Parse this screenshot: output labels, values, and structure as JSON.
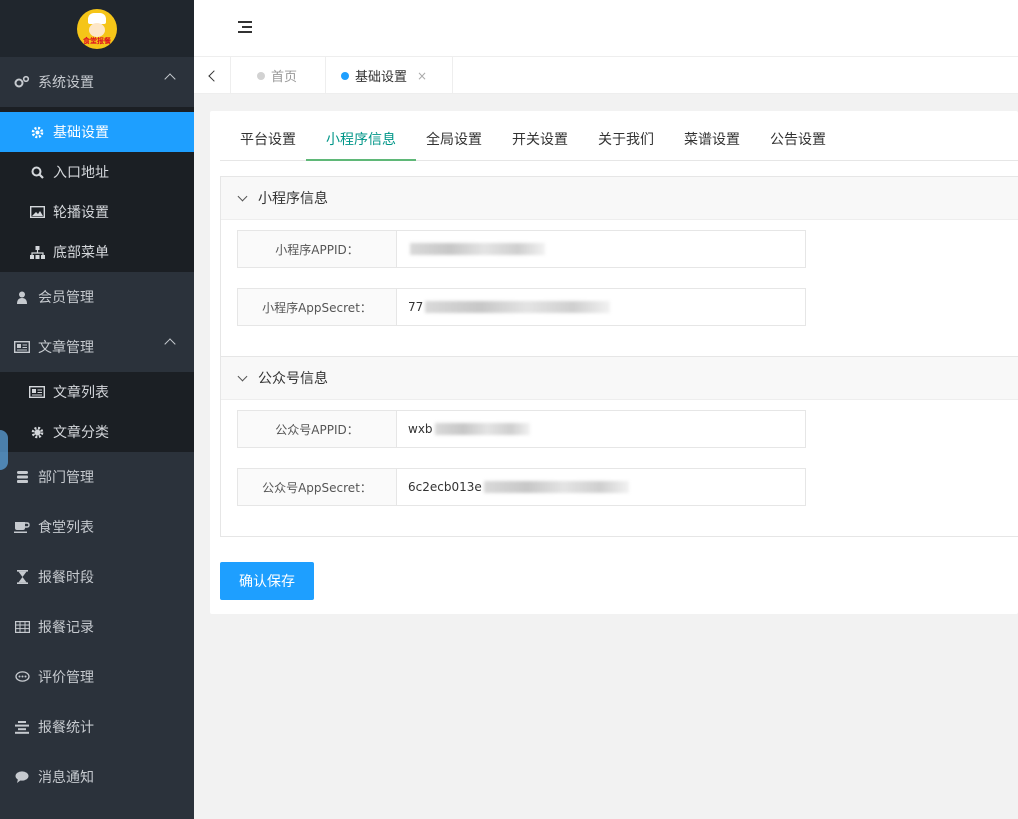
{
  "logo": {
    "text": "食堂报餐"
  },
  "sidebar": {
    "groups": [
      {
        "label": "系统设置",
        "icon": "gears-icon",
        "expanded": true,
        "items": [
          {
            "label": "基础设置",
            "icon": "gear-icon",
            "active": true
          },
          {
            "label": "入口地址",
            "icon": "search-icon"
          },
          {
            "label": "轮播设置",
            "icon": "image-icon"
          },
          {
            "label": "底部菜单",
            "icon": "sitemap-icon"
          }
        ]
      },
      {
        "label": "会员管理",
        "icon": "user-icon"
      },
      {
        "label": "文章管理",
        "icon": "newspaper-icon",
        "expanded": true,
        "items": [
          {
            "label": "文章列表",
            "icon": "newspaper-icon"
          },
          {
            "label": "文章分类",
            "icon": "cog-icon"
          }
        ]
      },
      {
        "label": "部门管理",
        "icon": "database-icon"
      },
      {
        "label": "食堂列表",
        "icon": "coffee-icon"
      },
      {
        "label": "报餐时段",
        "icon": "hourglass-icon"
      },
      {
        "label": "报餐记录",
        "icon": "table-icon"
      },
      {
        "label": "评价管理",
        "icon": "comment-dots-icon"
      },
      {
        "label": "报餐统计",
        "icon": "align-center-icon"
      },
      {
        "label": "消息通知",
        "icon": "comment-icon"
      }
    ]
  },
  "tabs": [
    {
      "label": "首页",
      "active": false
    },
    {
      "label": "基础设置",
      "active": true,
      "close": "×"
    }
  ],
  "inner_tabs": [
    "平台设置",
    "小程序信息",
    "全局设置",
    "开关设置",
    "关于我们",
    "菜谱设置",
    "公告设置"
  ],
  "inner_tab_active": "小程序信息",
  "sections": {
    "miniprogram": {
      "title": "小程序信息",
      "appid_label": "小程序APPID：",
      "appid_value": "",
      "secret_label": "小程序AppSecret：",
      "secret_value": "77"
    },
    "official": {
      "title": "公众号信息",
      "appid_label": "公众号APPID：",
      "appid_value": "wxb",
      "secret_label": "公众号AppSecret：",
      "secret_value": "6c2ecb013e"
    }
  },
  "save_button": "确认保存",
  "colors": {
    "accent": "#1e9fff",
    "sidebar_bg": "#2b323b",
    "tab_active": "#009688"
  }
}
